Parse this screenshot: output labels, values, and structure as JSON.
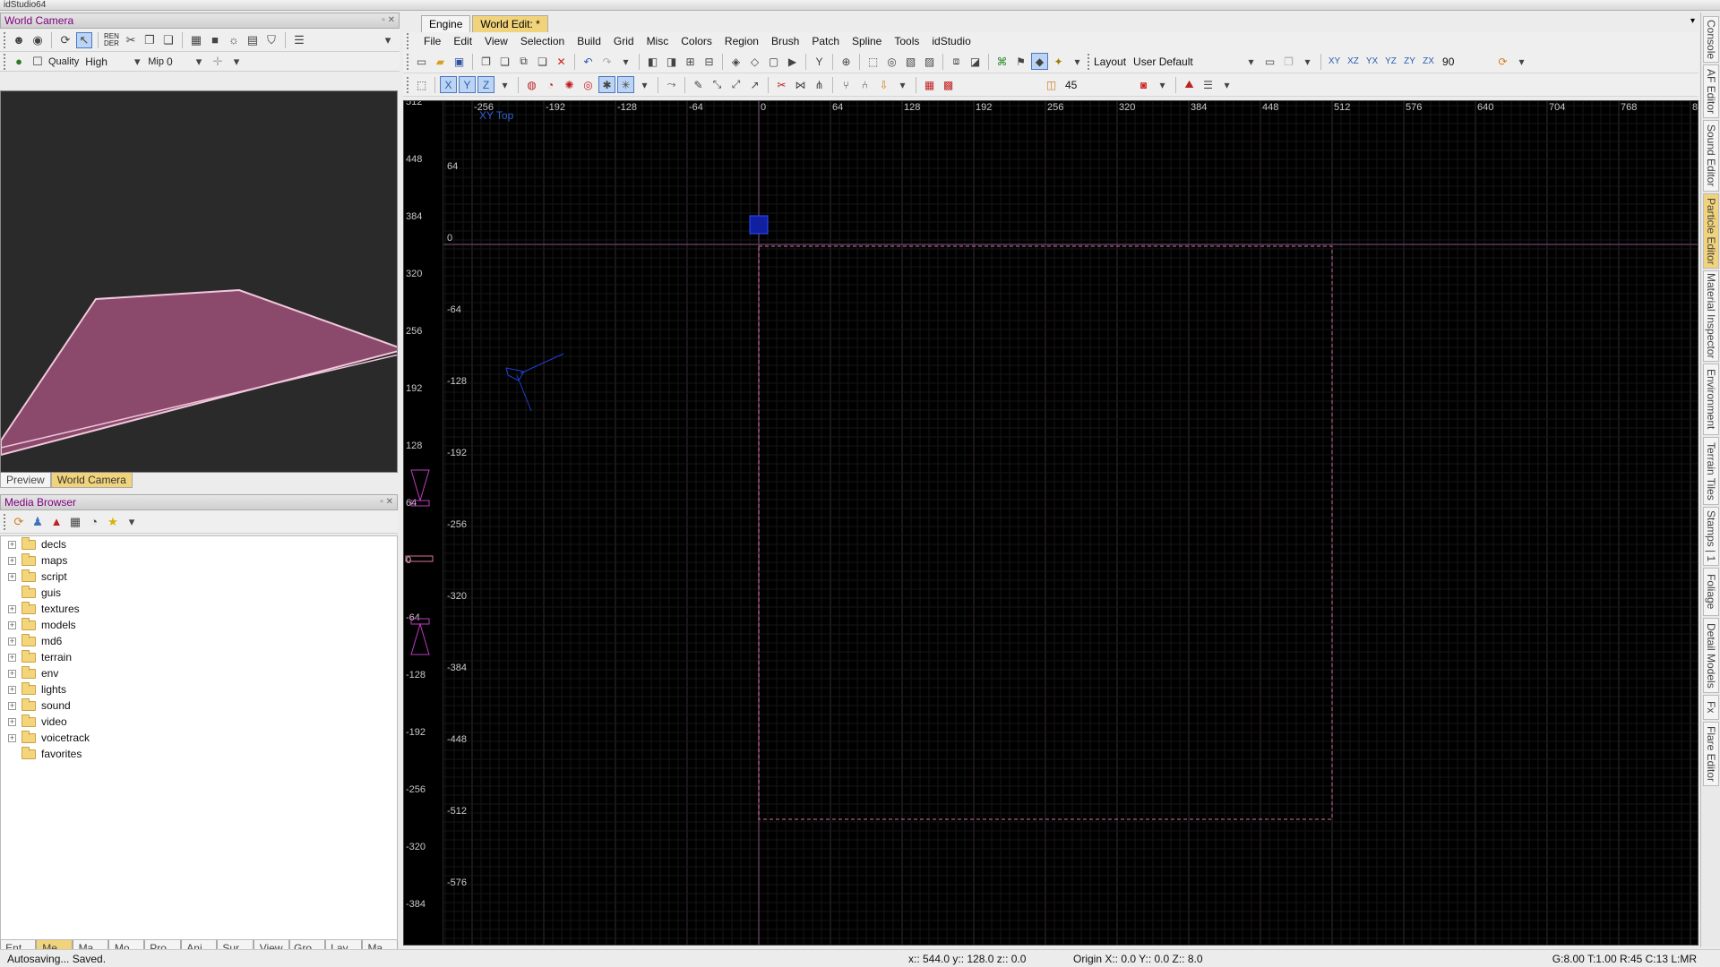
{
  "app": {
    "title": "idStudio64"
  },
  "world_camera": {
    "title": "World Camera",
    "quality_label": "Quality",
    "quality_value": "High",
    "mip_label": "Mip",
    "mip_value": "0",
    "render_label": "REN DER",
    "viewport_tabs": [
      "Preview",
      "World Camera"
    ]
  },
  "media_browser": {
    "title": "Media Browser",
    "items": [
      {
        "label": "decls",
        "expandable": true
      },
      {
        "label": "maps",
        "expandable": true
      },
      {
        "label": "script",
        "expandable": true
      },
      {
        "label": "guis",
        "expandable": false
      },
      {
        "label": "textures",
        "expandable": true
      },
      {
        "label": "models",
        "expandable": true
      },
      {
        "label": "md6",
        "expandable": true
      },
      {
        "label": "terrain",
        "expandable": true
      },
      {
        "label": "env",
        "expandable": true
      },
      {
        "label": "lights",
        "expandable": true
      },
      {
        "label": "sound",
        "expandable": true
      },
      {
        "label": "video",
        "expandable": true
      },
      {
        "label": "voicetrack",
        "expandable": true
      },
      {
        "label": "favorites",
        "expandable": false
      }
    ],
    "bottom_tabs": [
      "Ent...",
      "Me...",
      "Ma...",
      "Mo...",
      "Pro...",
      "Ani...",
      "Sur...",
      "View",
      "Gro...",
      "Lay...",
      "Ma..."
    ]
  },
  "world_edit": {
    "doc_tabs": [
      "Engine",
      "World Edit: *"
    ],
    "menu": [
      "File",
      "Edit",
      "View",
      "Selection",
      "Build",
      "Grid",
      "Misc",
      "Colors",
      "Region",
      "Brush",
      "Patch",
      "Spline",
      "Tools",
      "idStudio"
    ],
    "layout_label": "Layout",
    "layout_value": "User Default",
    "rotate_value": "90",
    "angle_value": "45",
    "view_label": "XY Top",
    "ruler_top": [
      "-256",
      "-192",
      "-128",
      "-64",
      "0",
      "64",
      "128",
      "192",
      "256",
      "320",
      "384",
      "448",
      "512",
      "576",
      "640",
      "704",
      "768",
      "8"
    ],
    "ruler_left": [
      "64",
      "0",
      "-64",
      "-128",
      "-192",
      "-256",
      "-320",
      "-384",
      "-448",
      "-512",
      "-576"
    ],
    "side_ruler": [
      "512",
      "448",
      "384",
      "320",
      "256",
      "192",
      "128",
      "64",
      "0",
      "-64",
      "-128",
      "-192",
      "-256",
      "-320",
      "-384"
    ]
  },
  "dock_tabs": [
    "Console",
    "AF Editor",
    "Sound Editor",
    "Particle Editor",
    "Material Inspector",
    "Environment",
    "Terrain Tiles",
    "Stamps | 1",
    "Foliage",
    "Detail Models",
    "Fx",
    "Flare Editor"
  ],
  "status": {
    "message": "Autosaving... Saved.",
    "coords": "x:: 544.0  y:: 128.0  z:: 0.0",
    "origin": "Origin X:: 0.0  Y:: 0.0  Z:: 8.0",
    "grid": "G:8.00 T:1.00 R:45 C:13 L:MR"
  },
  "colors": {
    "accent_tab": "#f0d37a",
    "panel_title": "#800080",
    "brush_fill": "#8b4a6b"
  }
}
